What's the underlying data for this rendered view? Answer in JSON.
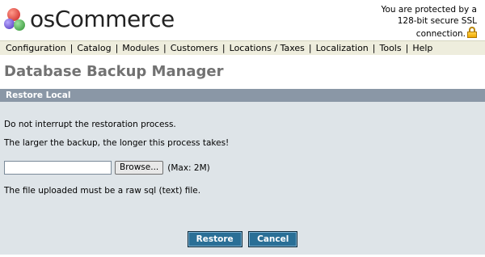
{
  "brand": {
    "name": "osCommerce"
  },
  "ssl": {
    "line1": "You are protected by a",
    "line2": "128-bit secure SSL",
    "line3": "connection."
  },
  "menu": {
    "items": [
      {
        "label": "Configuration"
      },
      {
        "label": "Catalog"
      },
      {
        "label": "Modules"
      },
      {
        "label": "Customers"
      },
      {
        "label": "Locations / Taxes"
      },
      {
        "label": "Localization"
      },
      {
        "label": "Tools"
      },
      {
        "label": "Help"
      }
    ]
  },
  "page": {
    "title": "Database Backup Manager"
  },
  "section": {
    "title": "Restore Local"
  },
  "content": {
    "warning": "Do not interrupt the restoration process.",
    "note": "The larger the backup, the longer this process takes!",
    "browse_label": "Browse...",
    "max_text": "(Max: 2M)",
    "file_note": "The file uploaded must be a raw sql (text) file.",
    "file_value": ""
  },
  "actions": {
    "restore_label": "Restore",
    "cancel_label": "Cancel"
  },
  "colors": {
    "menu_bg": "#eeeddd",
    "section_header_bg": "#8a97a6",
    "panel_bg": "#dee4e8",
    "button_bg": "#2a6f96"
  },
  "icons": {
    "logo": "oscommerce-logo-icon",
    "lock": "padlock-icon"
  }
}
